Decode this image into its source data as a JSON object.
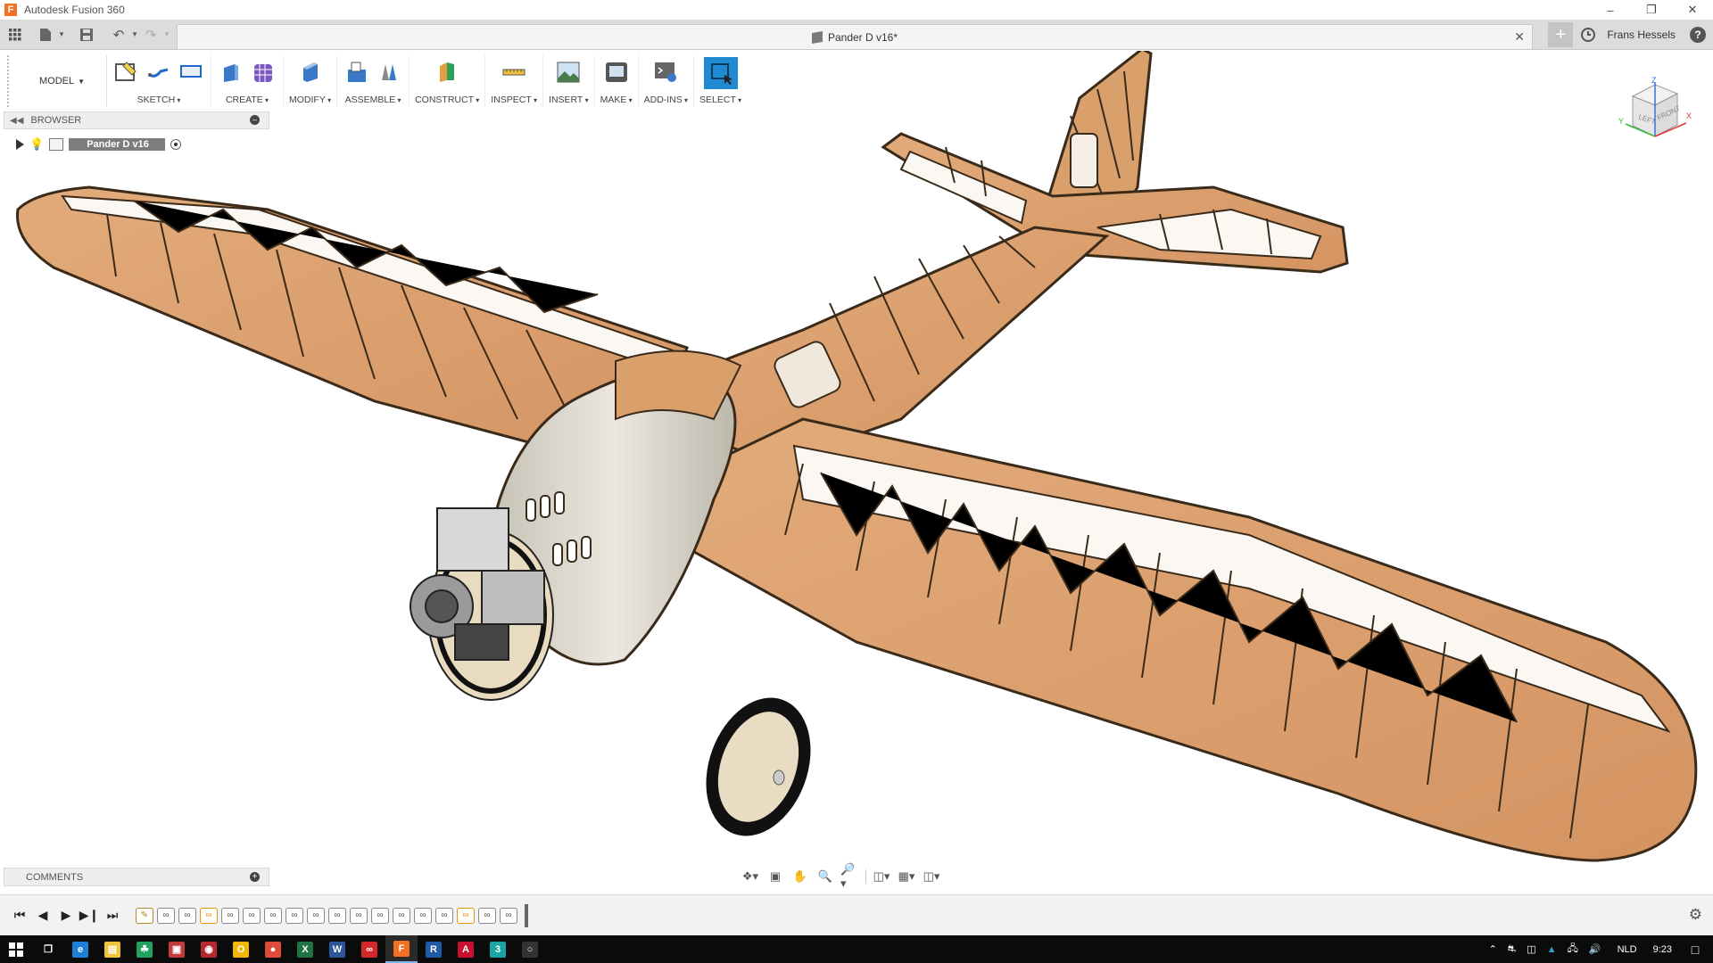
{
  "app": {
    "title": "Autodesk Fusion 360",
    "logo": "F"
  },
  "window_controls": {
    "minimize": "–",
    "restore": "❐",
    "close": "✕"
  },
  "quick_access": {
    "grid_icon": "apps-grid-icon",
    "file_icon": "file-icon",
    "save_icon": "save-icon",
    "undo_icon": "undo-icon",
    "redo_icon": "redo-icon"
  },
  "document_tab": {
    "name": "Pander D v16*",
    "close": "✕"
  },
  "header_right": {
    "add": "+",
    "user": "Frans Hessels",
    "help": "?"
  },
  "toolbar": {
    "workspace": "MODEL",
    "groups": [
      {
        "label": "SKETCH"
      },
      {
        "label": "CREATE"
      },
      {
        "label": "MODIFY"
      },
      {
        "label": "ASSEMBLE"
      },
      {
        "label": "CONSTRUCT"
      },
      {
        "label": "INSPECT"
      },
      {
        "label": "INSERT"
      },
      {
        "label": "MAKE"
      },
      {
        "label": "ADD-INS"
      },
      {
        "label": "SELECT"
      }
    ]
  },
  "browser": {
    "title": "BROWSER",
    "root_item": "Pander D v16"
  },
  "comments": {
    "title": "COMMENTS"
  },
  "viewcube": {
    "faces": [
      "LEFT",
      "FRONT"
    ],
    "axes": [
      "Z",
      "X",
      "Y"
    ],
    "colors": {
      "z": "#3a6fe0",
      "x": "#e03a3a",
      "y": "#38b838"
    }
  },
  "timeline": {
    "controls": [
      "⏮",
      "◀",
      "▶",
      "▶|",
      "⏭"
    ],
    "features": [
      "sketch",
      "joint",
      "joint",
      "orange",
      "joint",
      "joint",
      "joint",
      "joint",
      "joint",
      "joint",
      "joint",
      "joint",
      "joint",
      "joint",
      "joint",
      "orange",
      "joint",
      "joint"
    ]
  },
  "taskbar": {
    "apps": [
      {
        "name": "task-view",
        "color": "#0b0b0b",
        "glyph": "❐"
      },
      {
        "name": "edge",
        "color": "#1e7fd8",
        "glyph": "e"
      },
      {
        "name": "explorer",
        "color": "#f0c33c",
        "glyph": "▤"
      },
      {
        "name": "app-green",
        "color": "#22a060",
        "glyph": "☘"
      },
      {
        "name": "app-red-1",
        "color": "#c43a3a",
        "glyph": "▣"
      },
      {
        "name": "app-red-2",
        "color": "#b5282e",
        "glyph": "◉"
      },
      {
        "name": "app-yellow",
        "color": "#f2b705",
        "glyph": "O"
      },
      {
        "name": "chrome",
        "color": "#dd4b39",
        "glyph": "●"
      },
      {
        "name": "excel",
        "color": "#217346",
        "glyph": "X"
      },
      {
        "name": "word",
        "color": "#2b579a",
        "glyph": "W"
      },
      {
        "name": "creative-cloud",
        "color": "#d4272a",
        "glyph": "∞"
      },
      {
        "name": "fusion-360",
        "color": "#f36f21",
        "glyph": "F",
        "active": true
      },
      {
        "name": "revit",
        "color": "#1e5aa8",
        "glyph": "R"
      },
      {
        "name": "autocad",
        "color": "#c8102e",
        "glyph": "A"
      },
      {
        "name": "app-teal",
        "color": "#1aa5a5",
        "glyph": "3"
      },
      {
        "name": "app-dim",
        "color": "#333333",
        "glyph": "○"
      }
    ],
    "tray": {
      "language": "NLD",
      "time": "9:23"
    }
  }
}
